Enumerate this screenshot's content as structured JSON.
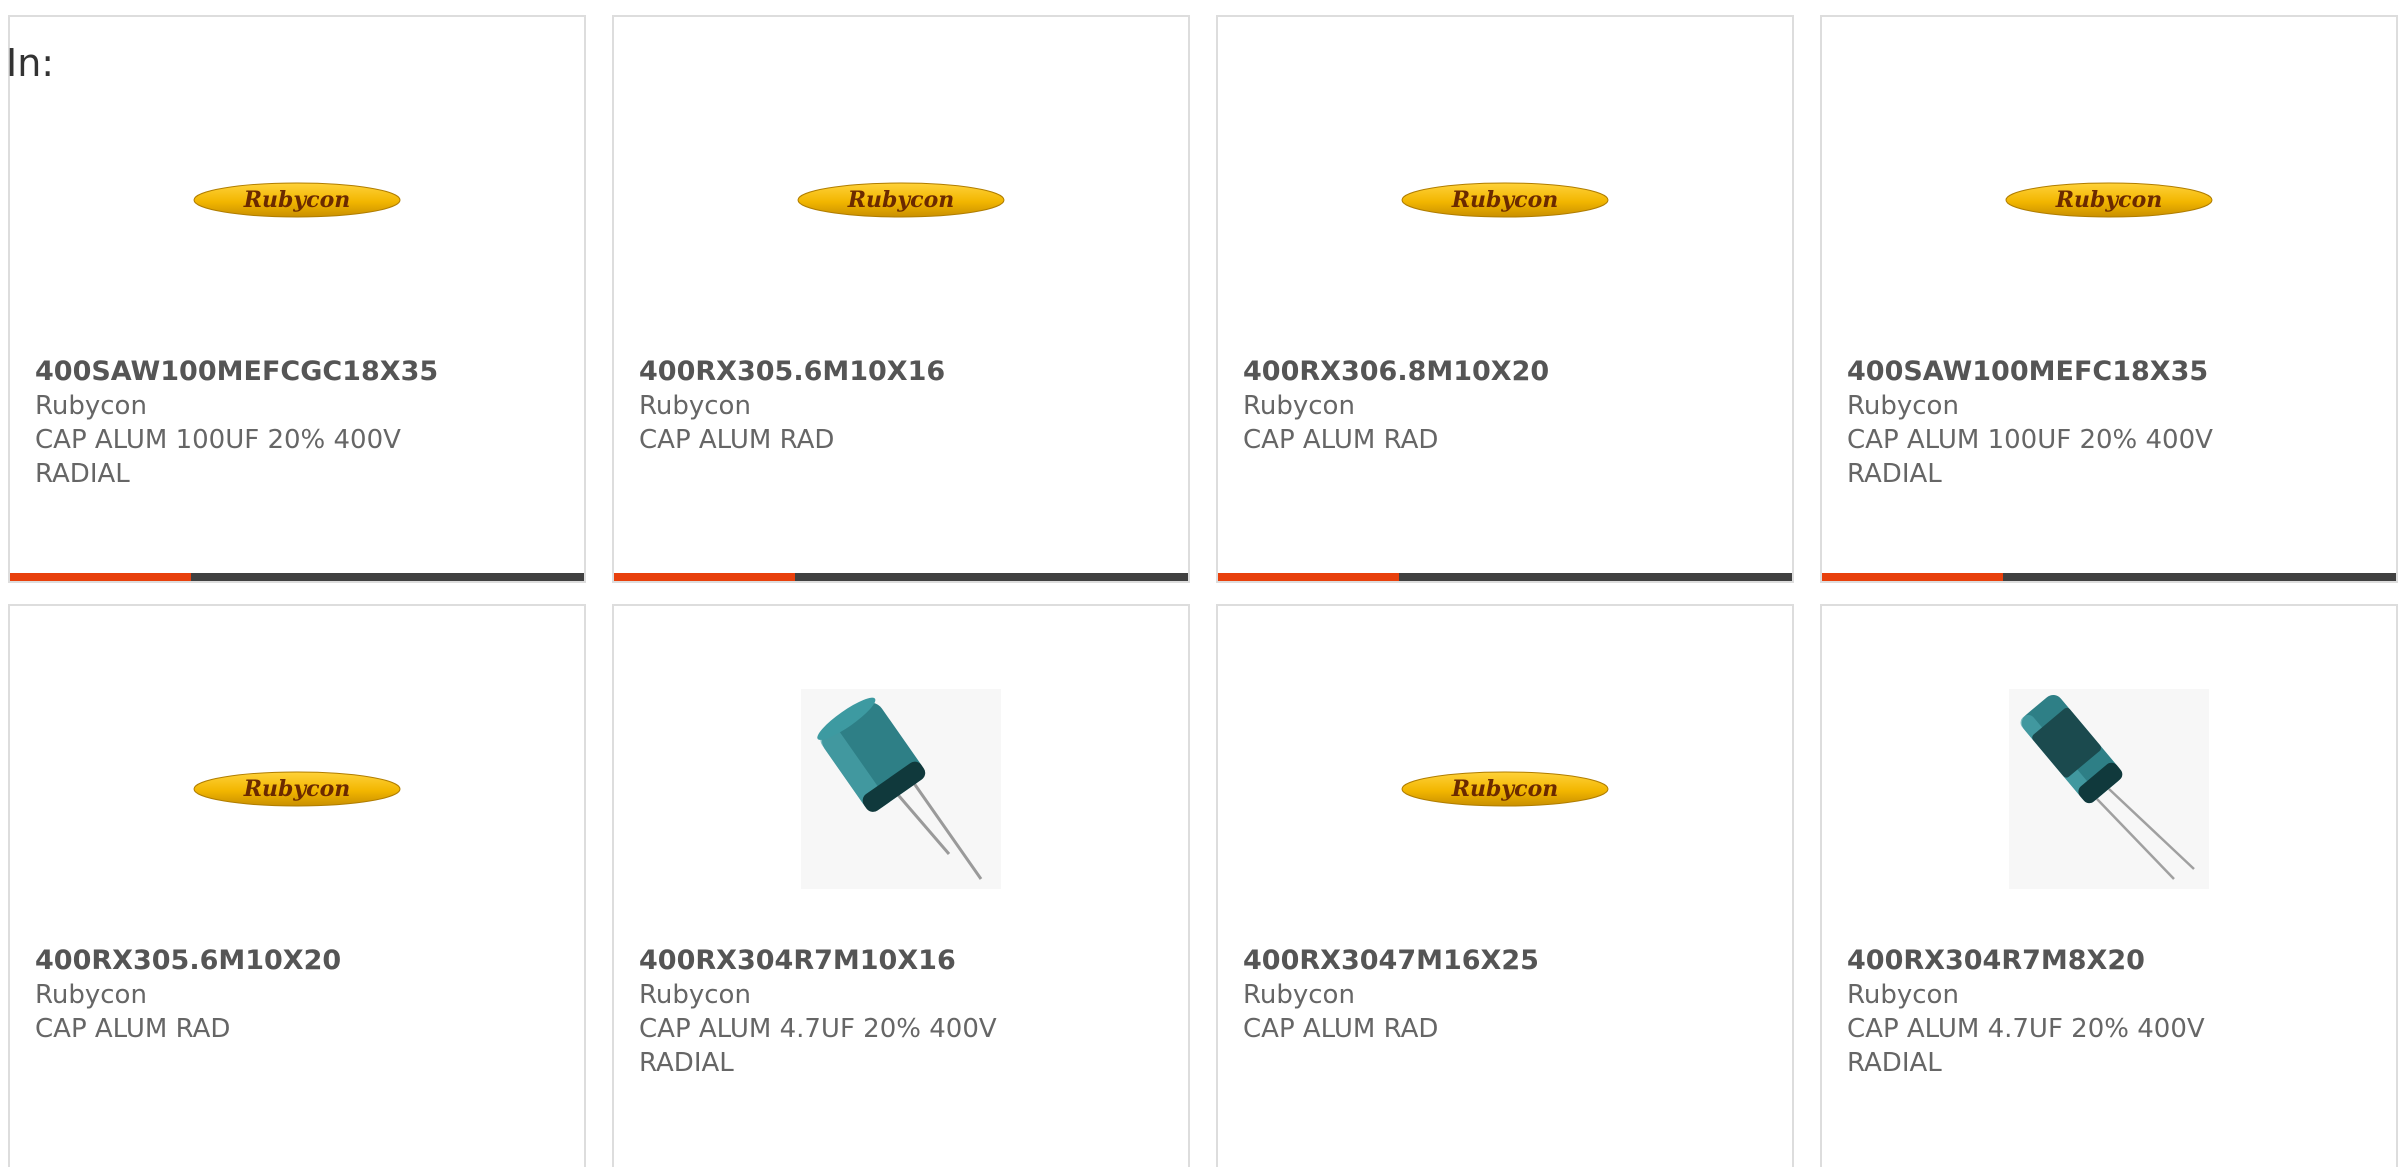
{
  "header": {
    "label": "In:"
  },
  "brand_logo_text": "Rubycon",
  "colors": {
    "accent_bar": "#e8400c",
    "bar_track": "#404040",
    "logo_yellow": "#f2b600",
    "capacitor_body": "#2e7f86"
  },
  "products": [
    {
      "part": "400SAW100MEFCGC18X35",
      "manufacturer": "Rubycon",
      "description": "CAP ALUM 100UF 20% 400V RADIAL",
      "image": "rubycon-logo",
      "has_bar": true
    },
    {
      "part": "400RX305.6M10X16",
      "manufacturer": "Rubycon",
      "description": "CAP ALUM RAD",
      "image": "rubycon-logo",
      "has_bar": true
    },
    {
      "part": "400RX306.8M10X20",
      "manufacturer": "Rubycon",
      "description": "CAP ALUM RAD",
      "image": "rubycon-logo",
      "has_bar": true
    },
    {
      "part": "400SAW100MEFC18X35",
      "manufacturer": "Rubycon",
      "description": "CAP ALUM 100UF 20% 400V RADIAL",
      "image": "rubycon-logo",
      "has_bar": true
    },
    {
      "part": "400RX305.6M10X20",
      "manufacturer": "Rubycon",
      "description": "CAP ALUM RAD",
      "image": "rubycon-logo",
      "has_bar": false
    },
    {
      "part": "400RX304R7M10X16",
      "manufacturer": "Rubycon",
      "description": "CAP ALUM 4.7UF 20% 400V RADIAL",
      "image": "capacitor-photo",
      "has_bar": false
    },
    {
      "part": "400RX3047M16X25",
      "manufacturer": "Rubycon",
      "description": "CAP ALUM RAD",
      "image": "rubycon-logo",
      "has_bar": false
    },
    {
      "part": "400RX304R7M8X20",
      "manufacturer": "Rubycon",
      "description": "CAP ALUM 4.7UF 20% 400V RADIAL",
      "image": "capacitor-photo-slim",
      "has_bar": false
    }
  ]
}
